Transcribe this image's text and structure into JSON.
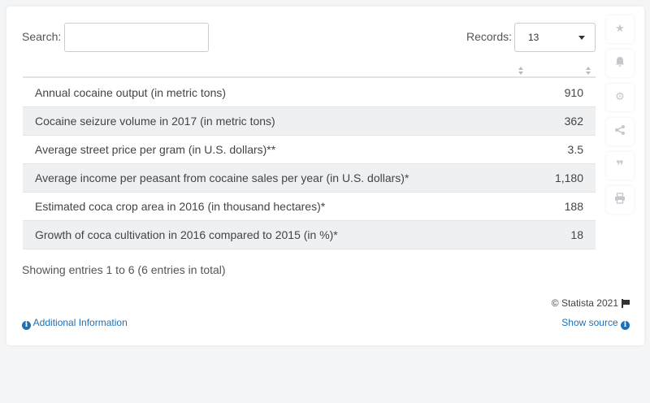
{
  "search": {
    "label": "Search:",
    "value": ""
  },
  "records": {
    "label": "Records:",
    "value": "13"
  },
  "rows": [
    {
      "label": "Annual cocaine output (in metric tons)",
      "value": "910"
    },
    {
      "label": "Cocaine seizure volume in 2017 (in metric tons)",
      "value": "362"
    },
    {
      "label": "Average street price per gram (in U.S. dollars)**",
      "value": "3.5"
    },
    {
      "label": "Average income per peasant from cocaine sales per year (in U.S. dollars)*",
      "value": "1,180"
    },
    {
      "label": "Estimated coca crop area in 2016 (in thousand hectares)*",
      "value": "188"
    },
    {
      "label": "Growth of coca cultivation in 2016 compared to 2015 (in %)*",
      "value": "18"
    }
  ],
  "footer": {
    "showing": "Showing entries 1 to 6 (6 entries in total)",
    "copyright": "© Statista 2021",
    "additional_info": "Additional Information",
    "show_source": "Show source"
  },
  "sidebar": {
    "icons": [
      "star-icon",
      "bell-icon",
      "gear-icon",
      "share-icon",
      "quote-icon",
      "print-icon"
    ]
  },
  "colors": {
    "link": "#1f6fb5",
    "row_alt": "#eef0f2"
  }
}
